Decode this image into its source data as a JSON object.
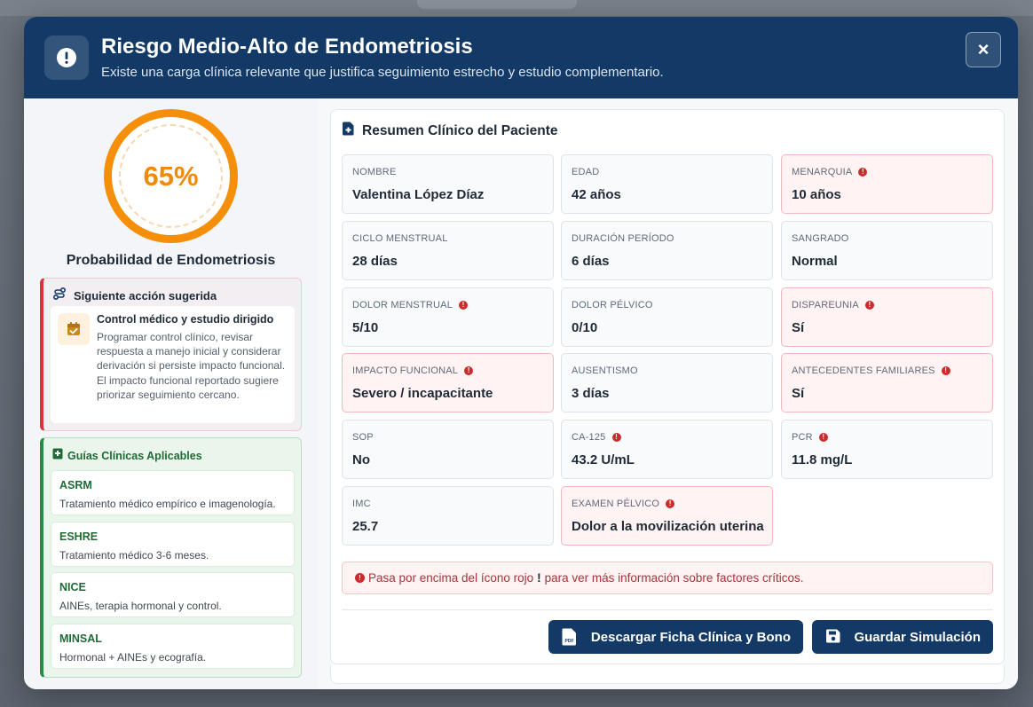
{
  "header": {
    "title": "Riesgo Medio-Alto de Endometriosis",
    "subtitle": "Existe una carga clínica relevante que justifica seguimiento estrecho y estudio complementario.",
    "close_label": "×"
  },
  "gauge": {
    "value_text": "65%",
    "probability": 0.65,
    "label": "Probabilidad de Endometriosis",
    "color": "#f58f0a"
  },
  "action": {
    "heading": "Siguiente acción sugerida",
    "title": "Control médico y estudio dirigido",
    "description": "Programar control clínico, revisar respuesta a manejo inicial y considerar derivación si persiste impacto funcional. El impacto funcional reportado sugiere priorizar seguimiento cercano.",
    "accent_color": "#d6343c"
  },
  "guides": {
    "heading": "Guías Clínicas Aplicables",
    "items": [
      {
        "name": "ASRM",
        "desc": "Tratamiento médico empírico e imagenología."
      },
      {
        "name": "ESHRE",
        "desc": "Tratamiento médico 3-6 meses."
      },
      {
        "name": "NICE",
        "desc": "AINEs, terapia hormonal y control."
      },
      {
        "name": "MINSAL",
        "desc": "Hormonal + AINEs y ecografía."
      }
    ]
  },
  "summary": {
    "heading": "Resumen Clínico del Paciente",
    "fields": [
      {
        "label": "NOMBRE",
        "value": "Valentina López Díaz",
        "critical": false
      },
      {
        "label": "EDAD",
        "value": "42 años",
        "critical": false
      },
      {
        "label": "MENARQUIA",
        "value": "10 años",
        "critical": true
      },
      {
        "label": "CICLO MENSTRUAL",
        "value": "28 días",
        "critical": false
      },
      {
        "label": "DURACIÓN PERÍODO",
        "value": "6 días",
        "critical": false
      },
      {
        "label": "SANGRADO",
        "value": "Normal",
        "critical": false
      },
      {
        "label": "DOLOR MENSTRUAL",
        "value": "5/10",
        "critical": false,
        "flag": true
      },
      {
        "label": "DOLOR PÉLVICO",
        "value": "0/10",
        "critical": false
      },
      {
        "label": "DISPAREUNIA",
        "value": "Sí",
        "critical": true
      },
      {
        "label": "IMPACTO FUNCIONAL",
        "value": "Severo / incapacitante",
        "critical": true
      },
      {
        "label": "AUSENTISMO",
        "value": "3 días",
        "critical": false
      },
      {
        "label": "ANTECEDENTES FAMILIARES",
        "value": "Sí",
        "critical": true
      },
      {
        "label": "SOP",
        "value": "No",
        "critical": false
      },
      {
        "label": "CA-125",
        "value": "43.2 U/mL",
        "critical": false,
        "flag": true
      },
      {
        "label": "PCR",
        "value": "11.8 mg/L",
        "critical": false,
        "flag": true
      },
      {
        "label": "IMC",
        "value": "25.7",
        "critical": false
      },
      {
        "label": "EXAMEN PÉLVICO",
        "value": "Dolor a la movilización uterina",
        "critical": true
      }
    ],
    "hint_before": "Pasa por encima del ícono rojo",
    "hint_mark": "!",
    "hint_after": "para ver más información sobre factores críticos."
  },
  "buttons": {
    "download": "Descargar Ficha Clínica y Bono",
    "save": "Guardar Simulación"
  },
  "colors": {
    "primary": "#133a66",
    "warning": "#cc2b2b",
    "success": "#2b8a44",
    "accent": "#f58f0a"
  }
}
